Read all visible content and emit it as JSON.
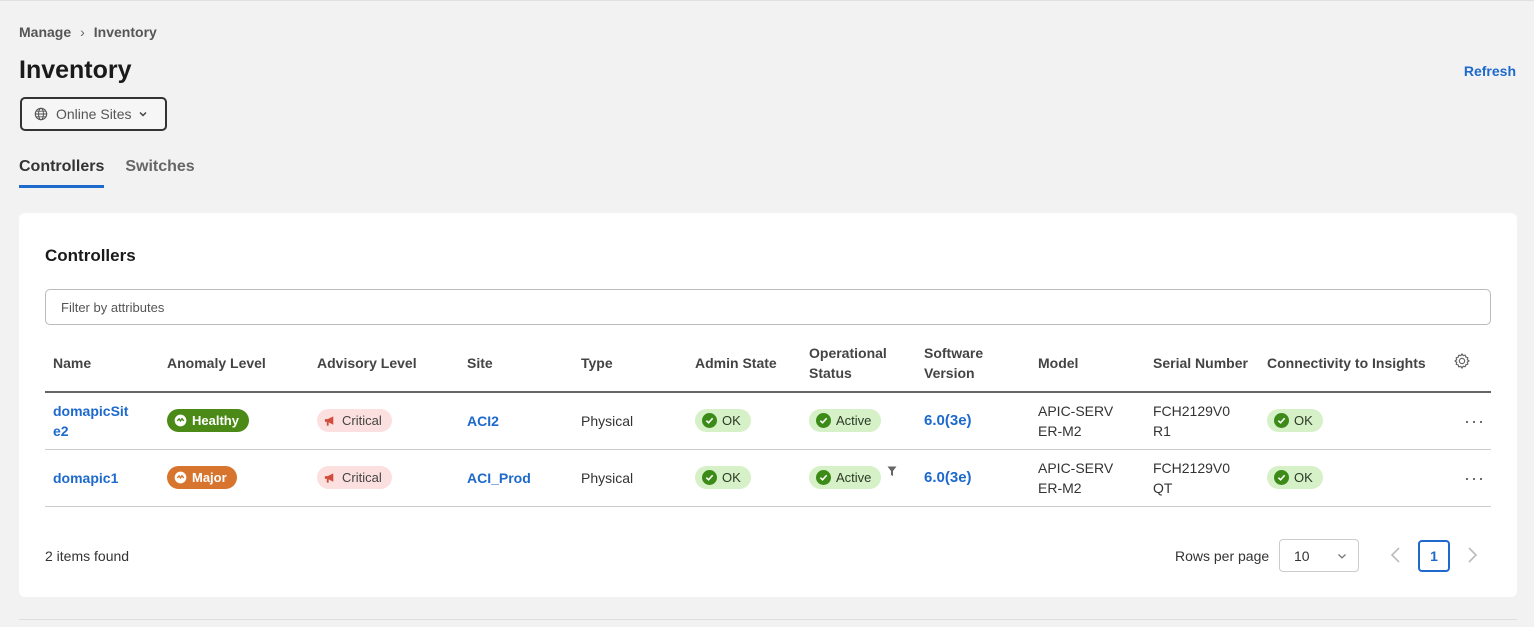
{
  "breadcrumb": {
    "parent": "Manage",
    "separator": "›",
    "current": "Inventory"
  },
  "page": {
    "title": "Inventory",
    "refresh_label": "Refresh"
  },
  "site_selector": {
    "label": "Online Sites",
    "icon": "globe-icon"
  },
  "tabs": [
    {
      "label": "Controllers",
      "active": true
    },
    {
      "label": "Switches",
      "active": false
    }
  ],
  "card": {
    "title": "Controllers",
    "filter_placeholder": "Filter by attributes"
  },
  "table": {
    "columns": {
      "name": "Name",
      "anomaly": "Anomaly Level",
      "advisory": "Advisory Level",
      "site": "Site",
      "type": "Type",
      "admin_state": "Admin State",
      "op_status_1": "Operational",
      "op_status_2": "Status",
      "sw_version_1": "Software",
      "sw_version_2": "Version",
      "model": "Model",
      "serial": "Serial Number",
      "connectivity": "Connectivity to Insights"
    },
    "rows": [
      {
        "name_1": "domapicSit",
        "name_2": "e2",
        "anomaly": "Healthy",
        "advisory": "Critical",
        "site": "ACI2",
        "type": "Physical",
        "admin_state": "OK",
        "op_status": "Active",
        "version": "6.0(3e)",
        "model_1": "APIC-SERV",
        "model_2": "ER-M2",
        "serial_1": "FCH2129V0",
        "serial_2": "R1",
        "connectivity": "OK"
      },
      {
        "name_1": "domapic1",
        "name_2": "",
        "anomaly": "Major",
        "advisory": "Critical",
        "site": "ACI_Prod",
        "type": "Physical",
        "admin_state": "OK",
        "op_status": "Active",
        "version": "6.0(3e)",
        "model_1": "APIC-SERV",
        "model_2": "ER-M2",
        "serial_1": "FCH2129V0",
        "serial_2": "QT",
        "connectivity": "OK"
      }
    ]
  },
  "footer": {
    "items_found": "2 items found",
    "rows_per_page_label": "Rows per page",
    "rows_per_page_value": "10",
    "current_page": "1"
  },
  "colors": {
    "accent": "#1d69cc",
    "healthy": "#4b8a16",
    "major": "#d7752e",
    "critical_bg": "#fbe0df",
    "ok_bg": "#d6f0c8"
  }
}
